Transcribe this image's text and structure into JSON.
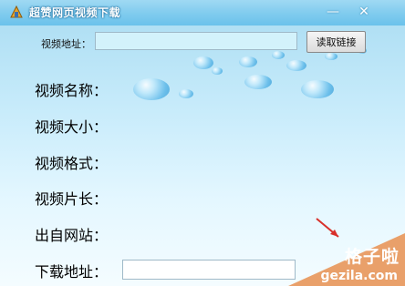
{
  "window": {
    "title": "超赞网页视频下载",
    "minimize_symbol": "—",
    "close_symbol": "✕",
    "app_icon": "app-logo-icon"
  },
  "url_section": {
    "label": "视频地址：",
    "value": "",
    "read_button_label": "读取链接"
  },
  "info": {
    "name_label": "视频名称：",
    "name_value": "",
    "size_label": "视频大小：",
    "size_value": "",
    "format_label": "视频格式：",
    "format_value": "",
    "duration_label": "视频片长：",
    "duration_value": "",
    "source_label": "出自网站：",
    "source_value": ""
  },
  "download": {
    "label": "下载地址：",
    "value": ""
  },
  "watermark": {
    "brand_cn": "格子啦",
    "brand_en": "gezila.com"
  },
  "colors": {
    "titlebar": "#7fcbee",
    "watermark": "#e9a06a",
    "arrow": "#d8302a"
  }
}
